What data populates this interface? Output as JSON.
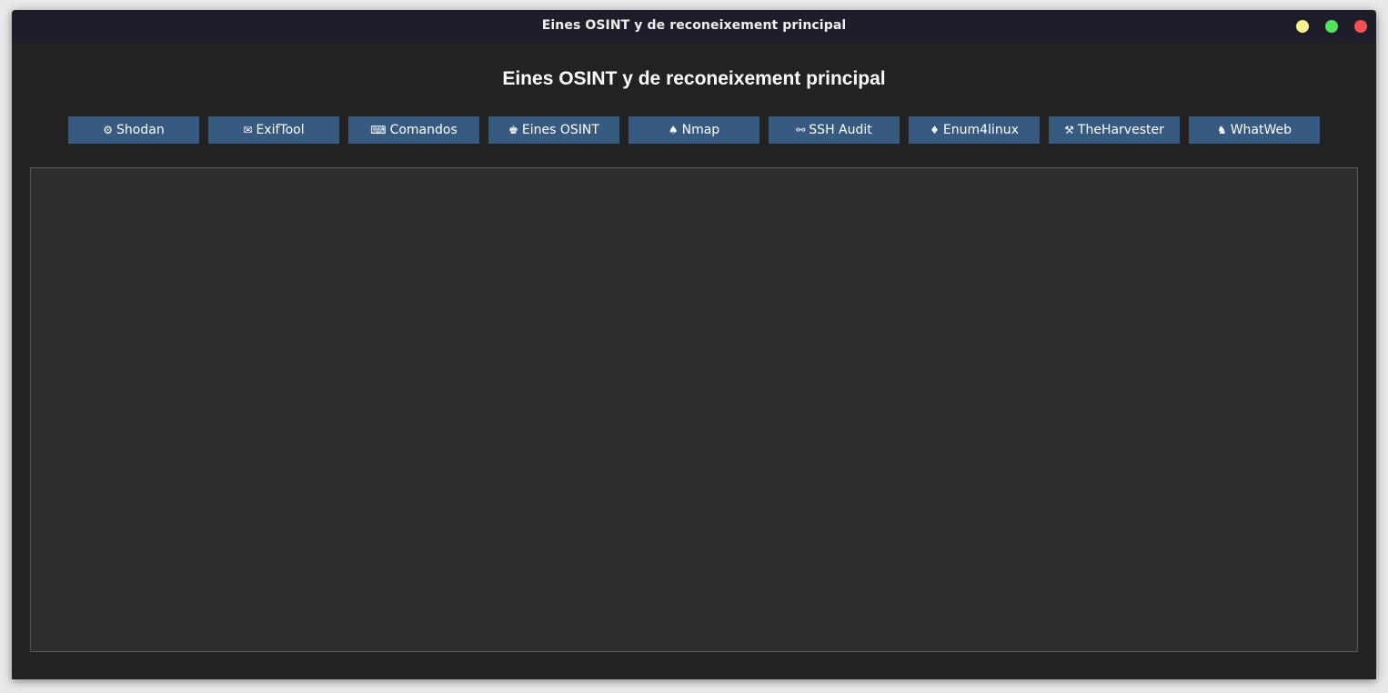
{
  "window": {
    "title": "Eines OSINT y de reconeixement principal",
    "controls": {
      "minimize_color": "#f4f08a",
      "maximize_color": "#55e35e",
      "close_color": "#f25050"
    }
  },
  "main": {
    "heading": "Eines OSINT y de reconeixement principal",
    "buttons": [
      {
        "icon": "⚙",
        "icon_name": "gear-icon",
        "label": "Shodan"
      },
      {
        "icon": "✉",
        "icon_name": "envelope-icon",
        "label": "ExifTool"
      },
      {
        "icon": "⌨",
        "icon_name": "keyboard-icon",
        "label": "Comandos"
      },
      {
        "icon": "♚",
        "icon_name": "chess-king-icon",
        "label": "Eines OSINT"
      },
      {
        "icon": "♠",
        "icon_name": "spade-icon",
        "label": "Nmap"
      },
      {
        "icon": "⚯",
        "icon_name": "link-icon",
        "label": "SSH Audit"
      },
      {
        "icon": "♦",
        "icon_name": "diamond-icon",
        "label": "Enum4linux"
      },
      {
        "icon": "⚒",
        "icon_name": "hammer-pick-icon",
        "label": "TheHarvester"
      },
      {
        "icon": "♞",
        "icon_name": "chess-knight-icon",
        "label": "WhatWeb"
      }
    ],
    "button_color": "#365a80"
  }
}
